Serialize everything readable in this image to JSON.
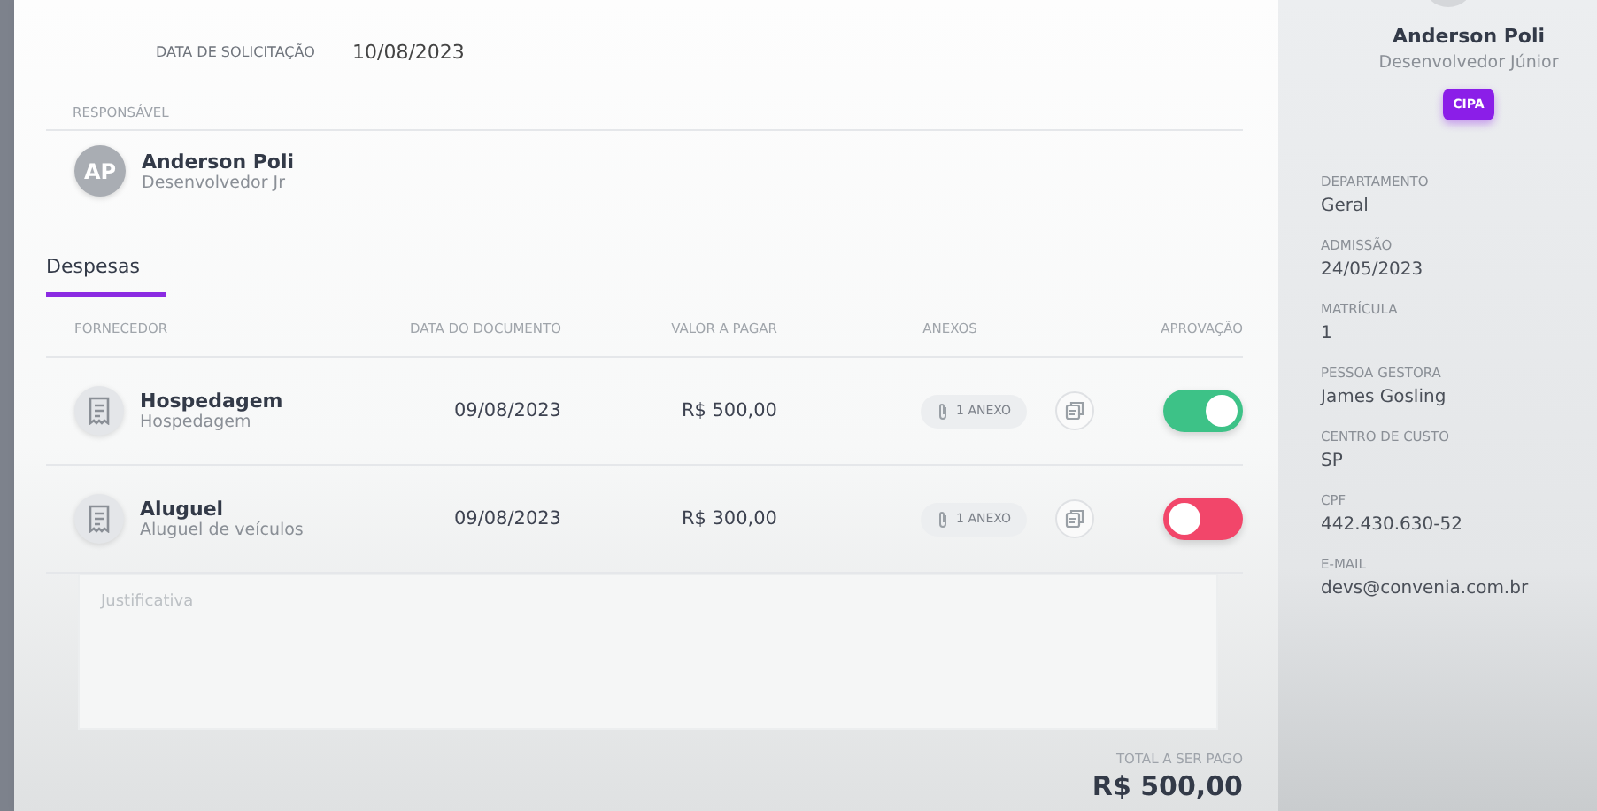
{
  "request": {
    "fields": [
      {
        "label": "DATA DE SOLICITAÇÃO",
        "value": "10/08/2023"
      }
    ]
  },
  "responsible": {
    "label": "RESPONSÁVEL",
    "initials": "AP",
    "name": "Anderson Poli",
    "role": "Desenvolvedor Jr"
  },
  "tabs": [
    {
      "label": "Despesas",
      "selected": true
    }
  ],
  "table": {
    "columns": [
      "FORNECEDOR",
      "DATA DO DOCUMENTO",
      "VALOR A PAGAR",
      "ANEXOS",
      "APROVAÇÃO"
    ],
    "rows": [
      {
        "title": "Hospedagem",
        "subtitle": "Hospedagem",
        "date": "09/08/2023",
        "amount": "R$ 500,00",
        "attachments": "1 ANEXO",
        "approved": true
      },
      {
        "title": "Aluguel",
        "subtitle": "Aluguel de veículos",
        "date": "09/08/2023",
        "amount": "R$ 300,00",
        "attachments": "1 ANEXO",
        "approved": false
      }
    ]
  },
  "justification": {
    "placeholder": "Justificativa"
  },
  "total": {
    "label": "TOTAL A SER PAGO",
    "value": "R$ 500,00"
  },
  "profile": {
    "name": "Anderson Poli",
    "role": "Desenvolvedor Júnior",
    "badge": "CIPA",
    "fields": [
      {
        "label": "DEPARTAMENTO",
        "value": "Geral"
      },
      {
        "label": "ADMISSÃO",
        "value": "24/05/2023"
      },
      {
        "label": "MATRÍCULA",
        "value": "1"
      },
      {
        "label": "PESSOA GESTORA",
        "value": "James Gosling"
      },
      {
        "label": "CENTRO DE CUSTO",
        "value": "SP"
      },
      {
        "label": "CPF",
        "value": "442.430.630-52"
      },
      {
        "label": "E-MAIL",
        "value": "devs@convenia.com.br"
      }
    ]
  }
}
